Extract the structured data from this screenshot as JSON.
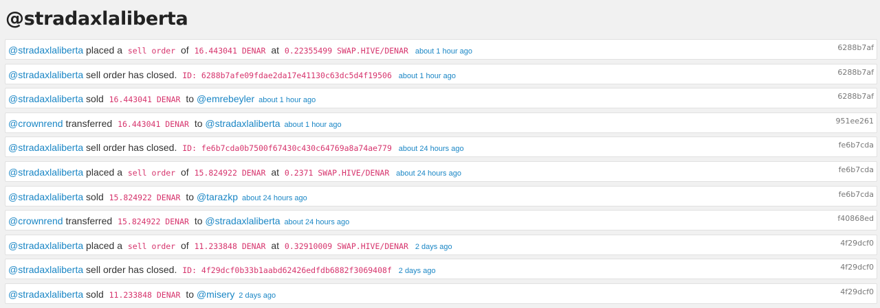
{
  "page": {
    "title": "@stradaxlaliberta"
  },
  "rows": [
    {
      "parts": [
        {
          "t": "user",
          "v": "@stradaxlaliberta"
        },
        {
          "t": "txt",
          "v": "placed a"
        },
        {
          "t": "code",
          "v": "sell order"
        },
        {
          "t": "txt",
          "v": "of"
        },
        {
          "t": "code",
          "v": "16.443041 DENAR"
        },
        {
          "t": "txt",
          "v": "at"
        },
        {
          "t": "code",
          "v": "0.22355499 SWAP.HIVE/DENAR"
        },
        {
          "t": "time",
          "v": "about 1 hour ago"
        }
      ],
      "hash": "6288b7af"
    },
    {
      "parts": [
        {
          "t": "user",
          "v": "@stradaxlaliberta"
        },
        {
          "t": "txt",
          "v": "sell order has closed."
        },
        {
          "t": "code",
          "v": "ID: 6288b7afe09fdae2da17e41130c63dc5d4f19506"
        },
        {
          "t": "time",
          "v": "about 1 hour ago"
        }
      ],
      "hash": "6288b7af"
    },
    {
      "parts": [
        {
          "t": "user",
          "v": "@stradaxlaliberta"
        },
        {
          "t": "txt",
          "v": "sold"
        },
        {
          "t": "code",
          "v": "16.443041 DENAR"
        },
        {
          "t": "txt",
          "v": "to"
        },
        {
          "t": "user",
          "v": "@emrebeyler"
        },
        {
          "t": "time",
          "v": "about 1 hour ago"
        }
      ],
      "hash": "6288b7af"
    },
    {
      "parts": [
        {
          "t": "user",
          "v": "@crownrend"
        },
        {
          "t": "txt",
          "v": "transferred"
        },
        {
          "t": "code",
          "v": "16.443041 DENAR"
        },
        {
          "t": "txt",
          "v": "to"
        },
        {
          "t": "user",
          "v": "@stradaxlaliberta"
        },
        {
          "t": "time",
          "v": "about 1 hour ago"
        }
      ],
      "hash": "951ee261"
    },
    {
      "parts": [
        {
          "t": "user",
          "v": "@stradaxlaliberta"
        },
        {
          "t": "txt",
          "v": "sell order has closed."
        },
        {
          "t": "code",
          "v": "ID: fe6b7cda0b7500f67430c430c64769a8a74ae779"
        },
        {
          "t": "time",
          "v": "about 24 hours ago"
        }
      ],
      "hash": "fe6b7cda"
    },
    {
      "parts": [
        {
          "t": "user",
          "v": "@stradaxlaliberta"
        },
        {
          "t": "txt",
          "v": "placed a"
        },
        {
          "t": "code",
          "v": "sell order"
        },
        {
          "t": "txt",
          "v": "of"
        },
        {
          "t": "code",
          "v": "15.824922 DENAR"
        },
        {
          "t": "txt",
          "v": "at"
        },
        {
          "t": "code",
          "v": "0.2371 SWAP.HIVE/DENAR"
        },
        {
          "t": "time",
          "v": "about 24 hours ago"
        }
      ],
      "hash": "fe6b7cda"
    },
    {
      "parts": [
        {
          "t": "user",
          "v": "@stradaxlaliberta"
        },
        {
          "t": "txt",
          "v": "sold"
        },
        {
          "t": "code",
          "v": "15.824922 DENAR"
        },
        {
          "t": "txt",
          "v": "to"
        },
        {
          "t": "user",
          "v": "@tarazkp"
        },
        {
          "t": "time",
          "v": "about 24 hours ago"
        }
      ],
      "hash": "fe6b7cda"
    },
    {
      "parts": [
        {
          "t": "user",
          "v": "@crownrend"
        },
        {
          "t": "txt",
          "v": "transferred"
        },
        {
          "t": "code",
          "v": "15.824922 DENAR"
        },
        {
          "t": "txt",
          "v": "to"
        },
        {
          "t": "user",
          "v": "@stradaxlaliberta"
        },
        {
          "t": "time",
          "v": "about 24 hours ago"
        }
      ],
      "hash": "f40868ed"
    },
    {
      "parts": [
        {
          "t": "user",
          "v": "@stradaxlaliberta"
        },
        {
          "t": "txt",
          "v": "placed a"
        },
        {
          "t": "code",
          "v": "sell order"
        },
        {
          "t": "txt",
          "v": "of"
        },
        {
          "t": "code",
          "v": "11.233848 DENAR"
        },
        {
          "t": "txt",
          "v": "at"
        },
        {
          "t": "code",
          "v": "0.32910009 SWAP.HIVE/DENAR"
        },
        {
          "t": "time",
          "v": "2 days ago"
        }
      ],
      "hash": "4f29dcf0"
    },
    {
      "parts": [
        {
          "t": "user",
          "v": "@stradaxlaliberta"
        },
        {
          "t": "txt",
          "v": "sell order has closed."
        },
        {
          "t": "code",
          "v": "ID: 4f29dcf0b33b1aabd62426edfdb6882f3069408f"
        },
        {
          "t": "time",
          "v": "2 days ago"
        }
      ],
      "hash": "4f29dcf0"
    },
    {
      "parts": [
        {
          "t": "user",
          "v": "@stradaxlaliberta"
        },
        {
          "t": "txt",
          "v": "sold"
        },
        {
          "t": "code",
          "v": "11.233848 DENAR"
        },
        {
          "t": "txt",
          "v": "to"
        },
        {
          "t": "user",
          "v": "@misery"
        },
        {
          "t": "time",
          "v": "2 days ago"
        }
      ],
      "hash": "4f29dcf0"
    }
  ]
}
